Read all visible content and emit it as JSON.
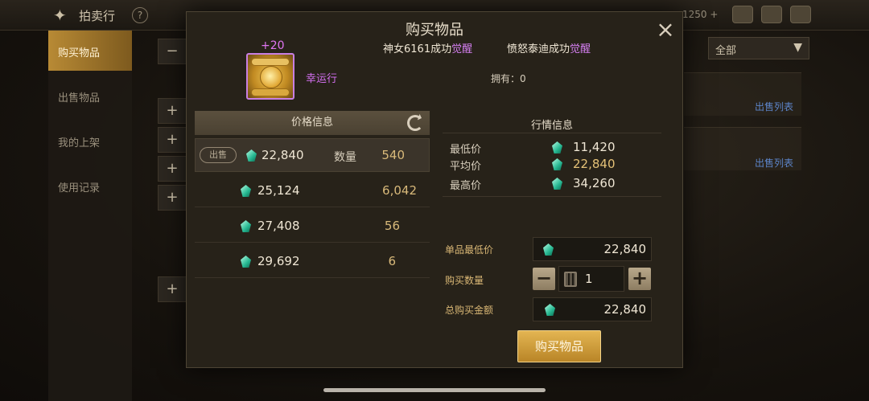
{
  "header": {
    "title": "拍卖行",
    "help": "?",
    "currency": "1250 +"
  },
  "side_nav": [
    {
      "label": "购买物品",
      "active": true
    },
    {
      "label": "出售物品",
      "active": false
    },
    {
      "label": "我的上架",
      "active": false
    },
    {
      "label": "使用记录",
      "active": false
    }
  ],
  "filter": {
    "value": "全部"
  },
  "sale_list_link": "出售列表",
  "dialog": {
    "title": "购买物品",
    "close": "×",
    "awaken_1": {
      "text": "神女6161成功",
      "highlight": "觉醒"
    },
    "awaken_2": {
      "text": "愤怒泰迪成功",
      "highlight": "觉醒"
    },
    "item": {
      "enhance": "+20",
      "name": "幸运行",
      "owned": "拥有：0"
    },
    "price_info": {
      "header": "价格信息",
      "sell_tag": "出售",
      "qty_label": "数量",
      "rows": [
        {
          "price": "22,840",
          "qty": "540"
        },
        {
          "price": "25,124",
          "qty": "6,042"
        },
        {
          "price": "27,408",
          "qty": "56"
        },
        {
          "price": "29,692",
          "qty": "6"
        }
      ]
    },
    "market_info": {
      "header": "行情信息",
      "lowest_label": "最低价",
      "lowest": "11,420",
      "avg_label": "平均价",
      "avg": "22,840",
      "highest_label": "最高价",
      "highest": "34,260"
    },
    "form": {
      "unit_low_label": "单品最低价",
      "unit_low": "22,840",
      "qty_label": "购买数量",
      "qty": "1",
      "minus": "−",
      "plus": "+",
      "total_label": "总购买金额",
      "total": "22,840"
    },
    "buy_button": "购买物品"
  },
  "colors": {
    "gold_accent": "#e3b552",
    "awaken_purple": "#d47ff0",
    "gem_green": "#27b892"
  }
}
